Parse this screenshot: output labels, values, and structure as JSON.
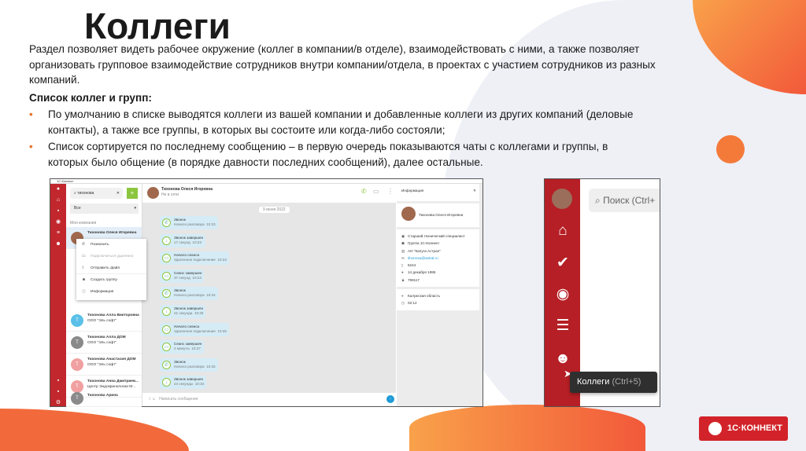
{
  "title": "Коллеги",
  "intro": "Раздел позволяет видеть рабочее окружение (коллег в компании/в отделе), взаимодействовать с ними, а также позволяет организовать групповое взаимодействие сотрудников внутри компании/отдела, в проектах с участием сотрудников из разных компаний.",
  "subheading": "Список коллег и групп:",
  "bullets": [
    "По умолчанию в списке выводятся коллеги из вашей компании и добавленные коллеги из других компаний (деловые контакты), а также все группы, в которых вы состоите или когда-либо состояли;",
    "Список сортируется по последнему сообщению – в первую очередь показываются чаты с коллегами и группы, в которых было общение (в порядке давности последних сообщений), далее остальные."
  ],
  "app": {
    "window_title": "1С-Коннект",
    "search_value": "тихонова",
    "filter": "Все",
    "section": "Моя компания",
    "selected_contact": "Тихонова Олеся Игоревна",
    "contacts": [
      {
        "name": "Тихонова Алла Викторовна",
        "org": "ООО \"Эль софт\"",
        "initial": "Т"
      },
      {
        "name": "Тихонова Алла ДОМ",
        "org": "ООО \"Эль софт\"",
        "initial": "Т"
      },
      {
        "name": "Тихонова Анастасия ДОМ",
        "org": "ООО \"Эль софт\"",
        "initial": "Т"
      },
      {
        "name": "Тихонова Анна Дмитриев...",
        "org": "Центр Эндокринологии М...",
        "initial": "Т"
      },
      {
        "name": "Тихонова Арина",
        "org": "",
        "initial": "Т"
      }
    ],
    "menu": [
      "Позвонить",
      "Подключиться удаленно",
      "Отправить файл",
      "Создать группу",
      "Информация"
    ],
    "chat_header": {
      "name": "Тихонова Олеся Игоревна",
      "status": "Не в сети"
    },
    "date": "9 июня 2022",
    "messages": [
      {
        "title": "Звонок",
        "sub": "Начало разговора",
        "time": "10:23"
      },
      {
        "title": "Звонок завершен",
        "sub": "17 секунд",
        "time": "10:23"
      },
      {
        "title": "Начало сеанса",
        "sub": "Удаленное подключение",
        "time": "10:23"
      },
      {
        "title": "Сеанс завершен",
        "sub": "37 секунд",
        "time": "10:24"
      },
      {
        "title": "Звонок",
        "sub": "Начало разговора",
        "time": "10:24"
      },
      {
        "title": "Звонок завершен",
        "sub": "21 секунда",
        "time": "10:25"
      },
      {
        "title": "Начало сеанса",
        "sub": "Удаленное подключение",
        "time": "10:25"
      },
      {
        "title": "Сеанс завершен",
        "sub": "2 минуты",
        "time": "10:27"
      },
      {
        "title": "Звонок",
        "sub": "Начало разговора",
        "time": "10:34"
      },
      {
        "title": "Звонок завершен",
        "sub": "24 секунды",
        "time": "10:34"
      }
    ],
    "composer_placeholder": "Написать сообщение",
    "info": {
      "title": "Информация",
      "name": "Тихонова Олеся Игоревна",
      "position": "Старший технический специалист",
      "group": "Группа 1С-Коннект",
      "company": "АО \"Калуга Астрал\"",
      "email": "tihonova@astral.ru",
      "ext": "6244",
      "birthday": "14 декабря 1995",
      "id": "799117",
      "region": "Калужская область",
      "local_time": "02:12"
    }
  },
  "zoom_shot": {
    "search_placeholder": "Поиск (Ctrl+",
    "tooltip_label": "Коллеги",
    "tooltip_shortcut": "(Ctrl+5)"
  },
  "logo": "1С·КОННЕКТ"
}
